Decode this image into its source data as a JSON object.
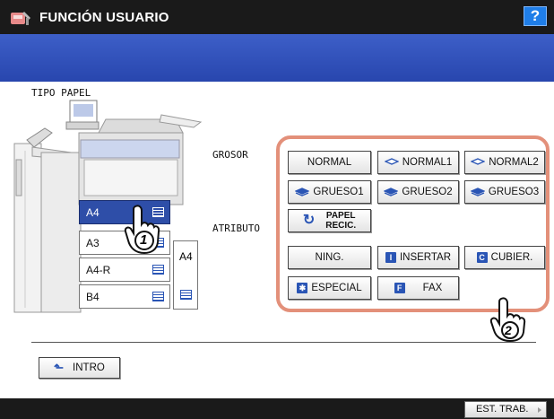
{
  "header": {
    "title": "FUNCIÓN USUARIO",
    "help_label": "?"
  },
  "section_label": "TIPO PAPEL",
  "trays": [
    {
      "label": "A4",
      "selected": true
    },
    {
      "label": "A3",
      "selected": false
    },
    {
      "label": "A4-R",
      "selected": false
    },
    {
      "label": "B4",
      "selected": false
    }
  ],
  "bypass_tray": {
    "label": "A4"
  },
  "labels": {
    "thickness": "GROSOR",
    "attribute": "ATRIBUTO"
  },
  "thickness_options": {
    "normal": "NORMAL",
    "normal1": "NORMAL1",
    "normal2": "NORMAL2",
    "grueso1": "GRUESO1",
    "grueso2": "GRUESO2",
    "grueso3": "GRUESO3",
    "recycled_line1": "PAPEL",
    "recycled_line2": "RECIC."
  },
  "attribute_options": {
    "none": "NING.",
    "insert": "INSERTAR",
    "cover": "CUBIER.",
    "special": "ESPECIAL",
    "fax": "FAX"
  },
  "callouts": {
    "step1": "1",
    "step2": "2"
  },
  "intro_label": "INTRO",
  "status_button": "EST. TRAB.",
  "colors": {
    "title_bar": "#1a1a1a",
    "blue_bar": "#3050b8",
    "panel_border": "#e3907a",
    "selected_tray": "#2e4ea8",
    "help_button": "#1f7ee8"
  }
}
